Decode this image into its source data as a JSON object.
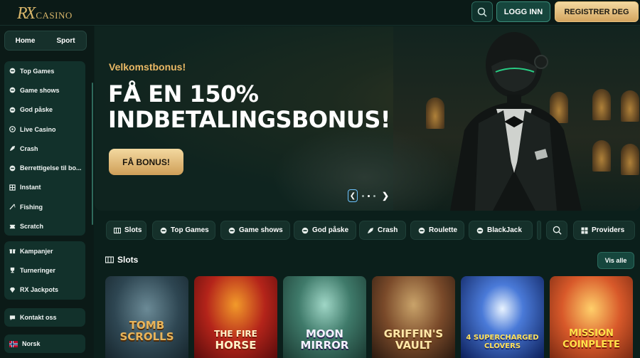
{
  "header": {
    "logo_mark": "RX",
    "logo_text": "CASINO",
    "search_icon": "search-icon",
    "login_label": "LOGG INN",
    "register_label": "REGISTRER DEG",
    "accent": "#d8b66a"
  },
  "sidebar": {
    "tabs": [
      {
        "label": "Home"
      },
      {
        "label": "Sport"
      }
    ],
    "games": [
      {
        "label": "Top Games",
        "icon": "chip-icon"
      },
      {
        "label": "Game shows",
        "icon": "chip-icon"
      },
      {
        "label": "God påske",
        "icon": "chip-icon"
      },
      {
        "label": "Live Casino",
        "icon": "roulette-icon"
      },
      {
        "label": "Crash",
        "icon": "rocket-icon"
      },
      {
        "label": "Berrettigelse til bo...",
        "icon": "chip-icon"
      },
      {
        "label": "Instant",
        "icon": "grid-icon"
      },
      {
        "label": "Fishing",
        "icon": "fishing-rod-icon"
      },
      {
        "label": "Scratch",
        "icon": "ticket-icon"
      }
    ],
    "promos": [
      {
        "label": "Kampanjer",
        "icon": "gift-icon"
      },
      {
        "label": "Turneringer",
        "icon": "trophy-icon"
      },
      {
        "label": "RX Jackpots",
        "icon": "diamond-icon"
      }
    ],
    "contact": {
      "label": "Kontakt oss",
      "icon": "chat-icon"
    },
    "language": {
      "label": "Norsk",
      "icon": "norway-flag-icon"
    }
  },
  "hero": {
    "subtitle": "Velkomstbonus!",
    "title_line1": "FÅ EN 150%",
    "title_line2": "INDBETALINGSBONUS!",
    "button_label": "FÅ BONUS!",
    "prev_glyph": "❮",
    "next_glyph": "❯",
    "slide_count": 4,
    "active_slide": 1
  },
  "categories": [
    {
      "label": "Slots",
      "icon": "slot-machine-icon"
    },
    {
      "label": "Top Games",
      "icon": "chip-icon"
    },
    {
      "label": "Game shows",
      "icon": "chip-icon"
    },
    {
      "label": "God påske",
      "icon": "chip-icon"
    },
    {
      "label": "Crash",
      "icon": "rocket-icon"
    },
    {
      "label": "Roulette",
      "icon": "chip-icon"
    },
    {
      "label": "BlackJack",
      "icon": "chip-icon"
    }
  ],
  "category_tools": {
    "search_icon": "search-icon",
    "providers_label": "Providers",
    "providers_icon": "grid-icon"
  },
  "slots": {
    "title": "Slots",
    "see_all": "Vis alle",
    "games": [
      {
        "line1": "Tomb",
        "line2": "Scrolls"
      },
      {
        "line1": "The Fire",
        "line2": "Horse"
      },
      {
        "line1": "Moon",
        "line2": "Mirror"
      },
      {
        "line1": "Griffin's",
        "line2": "Vault"
      },
      {
        "line1": "4 Supercharged",
        "line2": "Clovers"
      },
      {
        "line1": "Mission",
        "line2": "Coinplete"
      }
    ]
  }
}
